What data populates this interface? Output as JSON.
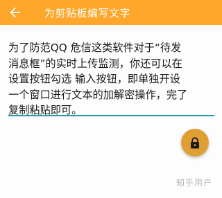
{
  "app_bar": {
    "title": "为剪贴板编写文字",
    "back_icon": "arrow-back-icon",
    "background_color": "#fda62a"
  },
  "editor": {
    "text": "为了防范QQ 危信这类软件对于“待发\n消息框”的实时上传监测，你还可以在\n设置按钮勾选 输入按钮，即单独开设\n一个窗口进行文本的加解密操作，完了\n复制粘贴即可。",
    "underline_color": "#1aa0a5"
  },
  "fab": {
    "icon": "lock-icon",
    "background_color": "#e09f32"
  },
  "watermark": {
    "text": "知乎用户"
  }
}
